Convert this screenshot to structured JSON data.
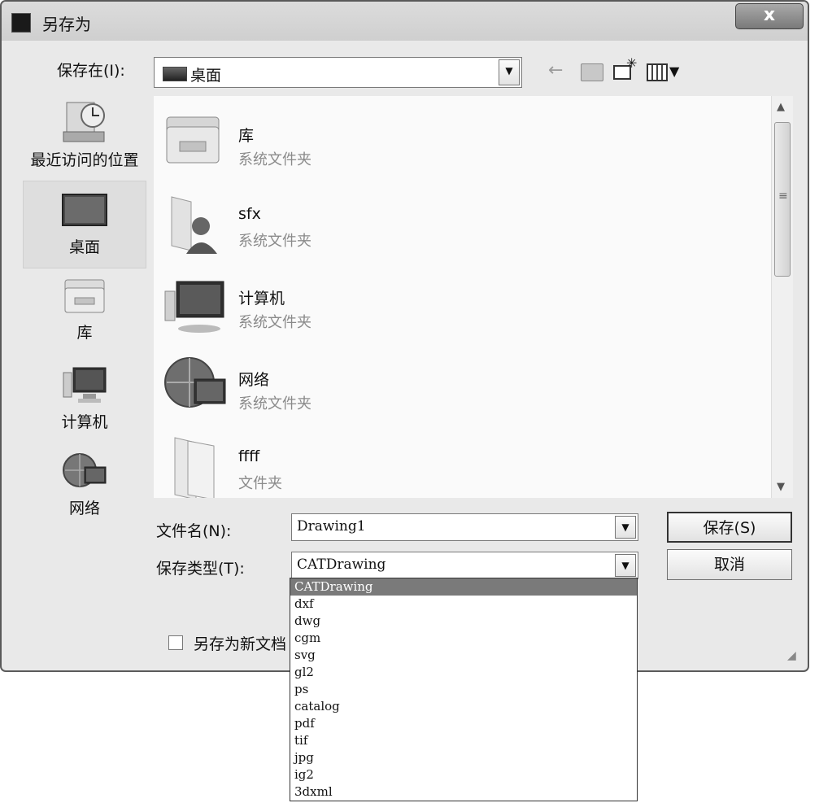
{
  "window": {
    "title": "另存为",
    "close_glyph": "x"
  },
  "toolbar": {
    "save_in_label": "保存在(I):",
    "save_in_value": "桌面",
    "dropdown_glyph": "▼",
    "back_icon": "back-arrow-icon",
    "up_icon": "up-folder-icon",
    "new_folder_icon": "new-folder-icon",
    "views_icon": "views-menu-icon"
  },
  "places": [
    {
      "label": "最近访问的位置",
      "icon": "recent-places-icon"
    },
    {
      "label": "桌面",
      "icon": "desktop-icon"
    },
    {
      "label": "库",
      "icon": "library-icon"
    },
    {
      "label": "计算机",
      "icon": "computer-icon"
    },
    {
      "label": "网络",
      "icon": "network-icon"
    }
  ],
  "files": [
    {
      "name": "库",
      "type": "系统文件夹",
      "icon": "library-folder-icon"
    },
    {
      "name": "sfx",
      "type": "系统文件夹",
      "icon": "user-folder-icon"
    },
    {
      "name": "计算机",
      "type": "系统文件夹",
      "icon": "computer-icon"
    },
    {
      "name": "网络",
      "type": "系统文件夹",
      "icon": "network-icon"
    },
    {
      "name": "ffff",
      "type": "文件夹",
      "icon": "folder-icon"
    }
  ],
  "form": {
    "filename_label": "文件名(N):",
    "filename_value": "Drawing1",
    "filetype_label": "保存类型(T):",
    "filetype_value": "CATDrawing",
    "save_button": "保存(S)",
    "cancel_button": "取消",
    "checkbox_label": "另存为新文档"
  },
  "filetype_options": [
    "CATDrawing",
    "dxf",
    "dwg",
    "cgm",
    "svg",
    "gl2",
    "ps",
    "catalog",
    "pdf",
    "tif",
    "jpg",
    "ig2",
    "3dxml"
  ],
  "selected_option": "CATDrawing"
}
